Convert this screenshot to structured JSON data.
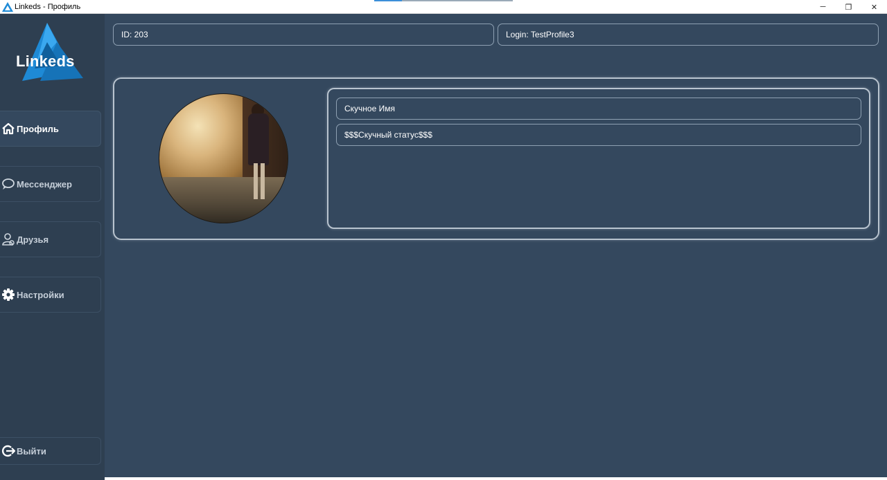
{
  "window": {
    "title": "Linkeds - Профиль",
    "controls": {
      "minimize": "─",
      "restore": "❐",
      "close": "✕"
    }
  },
  "sidebar": {
    "logo_text": "Linkeds",
    "items": [
      {
        "label": "Профиль",
        "icon": "home-icon",
        "active": true
      },
      {
        "label": "Мессенджер",
        "icon": "chat-icon",
        "active": false
      },
      {
        "label": "Друзья",
        "icon": "friend-icon",
        "active": false
      },
      {
        "label": "Настройки",
        "icon": "gear-icon",
        "active": false
      }
    ],
    "logout": {
      "label": "Выйти",
      "icon": "logout-icon"
    }
  },
  "header": {
    "id_field": "ID: 203",
    "login_field": "Login: TestProfile3"
  },
  "profile": {
    "name_field": "Скучное Имя",
    "status_field": "$$$Скучный статус$$$"
  },
  "colors": {
    "background": "#34485e",
    "sidebar": "#2e3f51",
    "border": "#b9c4cf",
    "logo_blue": "#1e8ad6"
  }
}
